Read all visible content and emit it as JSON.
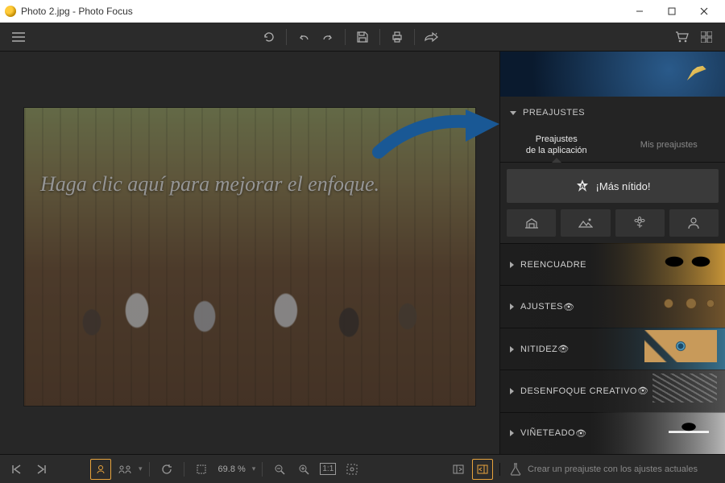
{
  "window": {
    "title": "Photo 2.jpg - Photo Focus"
  },
  "overlay": {
    "hint": "Haga clic aquí para mejorar el enfoque."
  },
  "sidebar": {
    "presets_header": "PREAJUSTES",
    "tabs": {
      "app_line1": "Preajustes",
      "app_line2": "de la aplicación",
      "mine": "Mis preajustes"
    },
    "main_preset": "¡Más nítido!",
    "sections": {
      "reencuadre": "REENCUADRE",
      "ajustes": "AJUSTES",
      "nitidez": "NITIDEZ",
      "desenfoque": "DESENFOQUE CREATIVO",
      "vineteado": "VIÑETEADO"
    }
  },
  "statusbar": {
    "zoom": "69.8 %",
    "create_preset": "Crear un preajuste con los ajustes actuales"
  },
  "colors": {
    "accent": "#e8a33c",
    "arrow": "#1e90ff"
  }
}
